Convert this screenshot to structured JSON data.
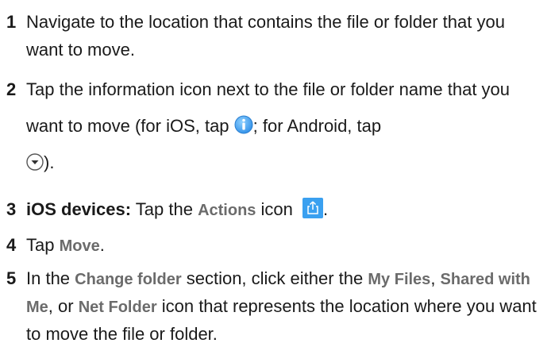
{
  "steps": [
    {
      "number": "1",
      "text": "Navigate to the location that contains the file or folder that you want to move."
    },
    {
      "number": "2",
      "text_a": "Tap the information icon next to the file or folder name that you want to move (for iOS, tap ",
      "text_b": "; for Android, tap ",
      "text_c": ")."
    },
    {
      "number": "3",
      "bold_lead": "iOS devices:",
      "text_a": " Tap the ",
      "ui_label": "Actions",
      "text_b": " icon ",
      "text_c": "."
    },
    {
      "number": "4",
      "text_a": "Tap ",
      "ui_label": "Move",
      "text_b": "."
    },
    {
      "number": "5",
      "text_a": "In the ",
      "ui_a": "Change folder",
      "text_b": " section, click either the ",
      "ui_b": "My Files",
      "text_c": ", ",
      "ui_c": "Shared with Me",
      "text_d": ", or ",
      "ui_d": "Net Folder",
      "text_e": " icon that represents the location where you want to move the file or folder."
    }
  ],
  "icons": {
    "info": "information-icon",
    "android_menu": "chevron-down-circle-icon",
    "actions": "share-actions-icon",
    "accent": "#3aa0f0"
  }
}
